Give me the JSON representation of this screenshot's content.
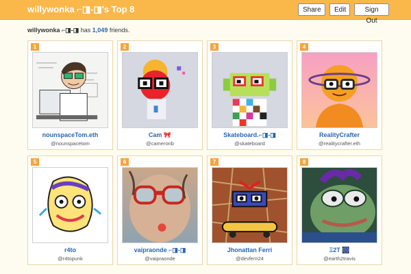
{
  "header": {
    "title": "willywonka ⌐◨-◨'s Top 8",
    "buttons": {
      "share": "Share",
      "edit": "Edit",
      "sign_out": "Sign Out"
    }
  },
  "summary": {
    "owner": "willywonka ⌐◨-◨",
    "has_text": " has ",
    "count": "1,049",
    "suffix": " friends."
  },
  "friends": [
    {
      "rank": "1",
      "name": "nounspaceTom.eth",
      "handle": "@nounspacetom"
    },
    {
      "rank": "2",
      "name": "Cam 🎀",
      "handle": "@cameronb"
    },
    {
      "rank": "3",
      "name": "Skateboard.⌐◨-◨",
      "handle": "@skateboard"
    },
    {
      "rank": "4",
      "name": "RealityCrafter",
      "handle": "@realitycrafter.eth"
    },
    {
      "rank": "5",
      "name": "r4to",
      "handle": "@r4topunk"
    },
    {
      "rank": "6",
      "name": "vaipraonde ⌐◨-◨",
      "handle": "@vaipraonde"
    },
    {
      "rank": "7",
      "name": "Jhonattan Ferri",
      "handle": "@devferri24"
    },
    {
      "rank": "8",
      "name": "Ξ2T 🎆",
      "handle": "@earth2travis"
    }
  ],
  "colors": {
    "topbar": "#fbb84a",
    "page_background": "#fefcf1",
    "rank_badge": "#f7a43a",
    "link": "#2a67b3"
  }
}
